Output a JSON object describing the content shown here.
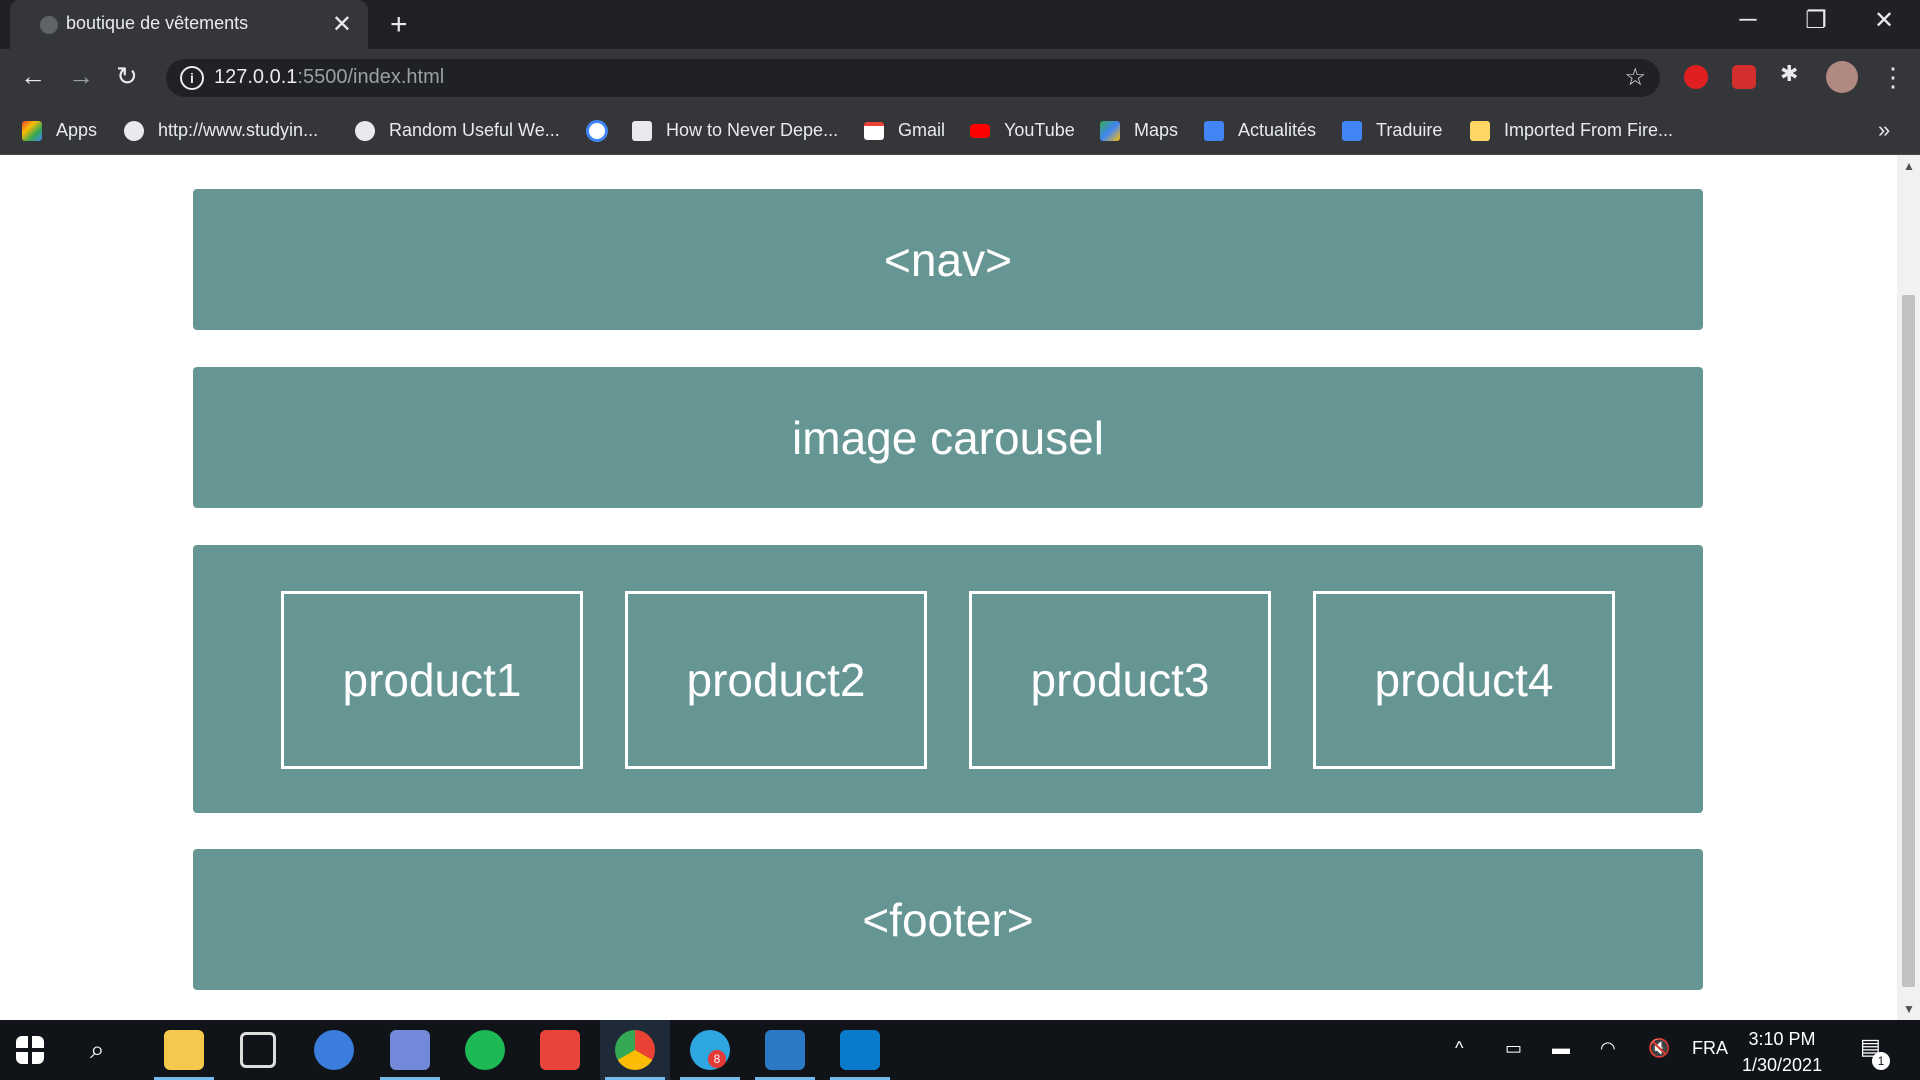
{
  "browser": {
    "tab_title": "boutique de vêtements",
    "url_host": "127.0.0.1",
    "url_rest": ":5500/index.html",
    "bookmarks": [
      {
        "label": "Apps",
        "icon": "apps-grid-icon",
        "color": "#ea4335"
      },
      {
        "label": "http://www.studyin...",
        "icon": "globe-icon",
        "color": "#e8eaed"
      },
      {
        "label": "Random Useful We...",
        "icon": "globe-icon",
        "color": "#e8eaed"
      },
      {
        "label": "",
        "icon": "google-icon",
        "color": "#4285f4"
      },
      {
        "label": "How to Never Depe...",
        "icon": "g2a-icon",
        "color": "#e8eaed"
      },
      {
        "label": "Gmail",
        "icon": "gmail-icon",
        "color": "#ea4335"
      },
      {
        "label": "YouTube",
        "icon": "youtube-icon",
        "color": "#ff0000"
      },
      {
        "label": "Maps",
        "icon": "maps-icon",
        "color": "#34a853"
      },
      {
        "label": "Actualités",
        "icon": "news-icon",
        "color": "#4285f4"
      },
      {
        "label": "Traduire",
        "icon": "translate-icon",
        "color": "#4285f4"
      },
      {
        "label": "Imported From Fire...",
        "icon": "folder-icon",
        "color": "#fdd663"
      }
    ]
  },
  "page": {
    "nav_label": "<nav>",
    "carousel_label": "image carousel",
    "products": [
      "product1",
      "product2",
      "product3",
      "product4"
    ],
    "footer_label": "<footer>"
  },
  "taskbar": {
    "language": "FRA",
    "time": "3:10 PM",
    "date": "1/30/2021",
    "telegram_badge": "8",
    "notification_count": "1"
  },
  "colors": {
    "block_bg": "#669694",
    "chrome_dark": "#202124",
    "chrome_mid": "#35363a"
  }
}
